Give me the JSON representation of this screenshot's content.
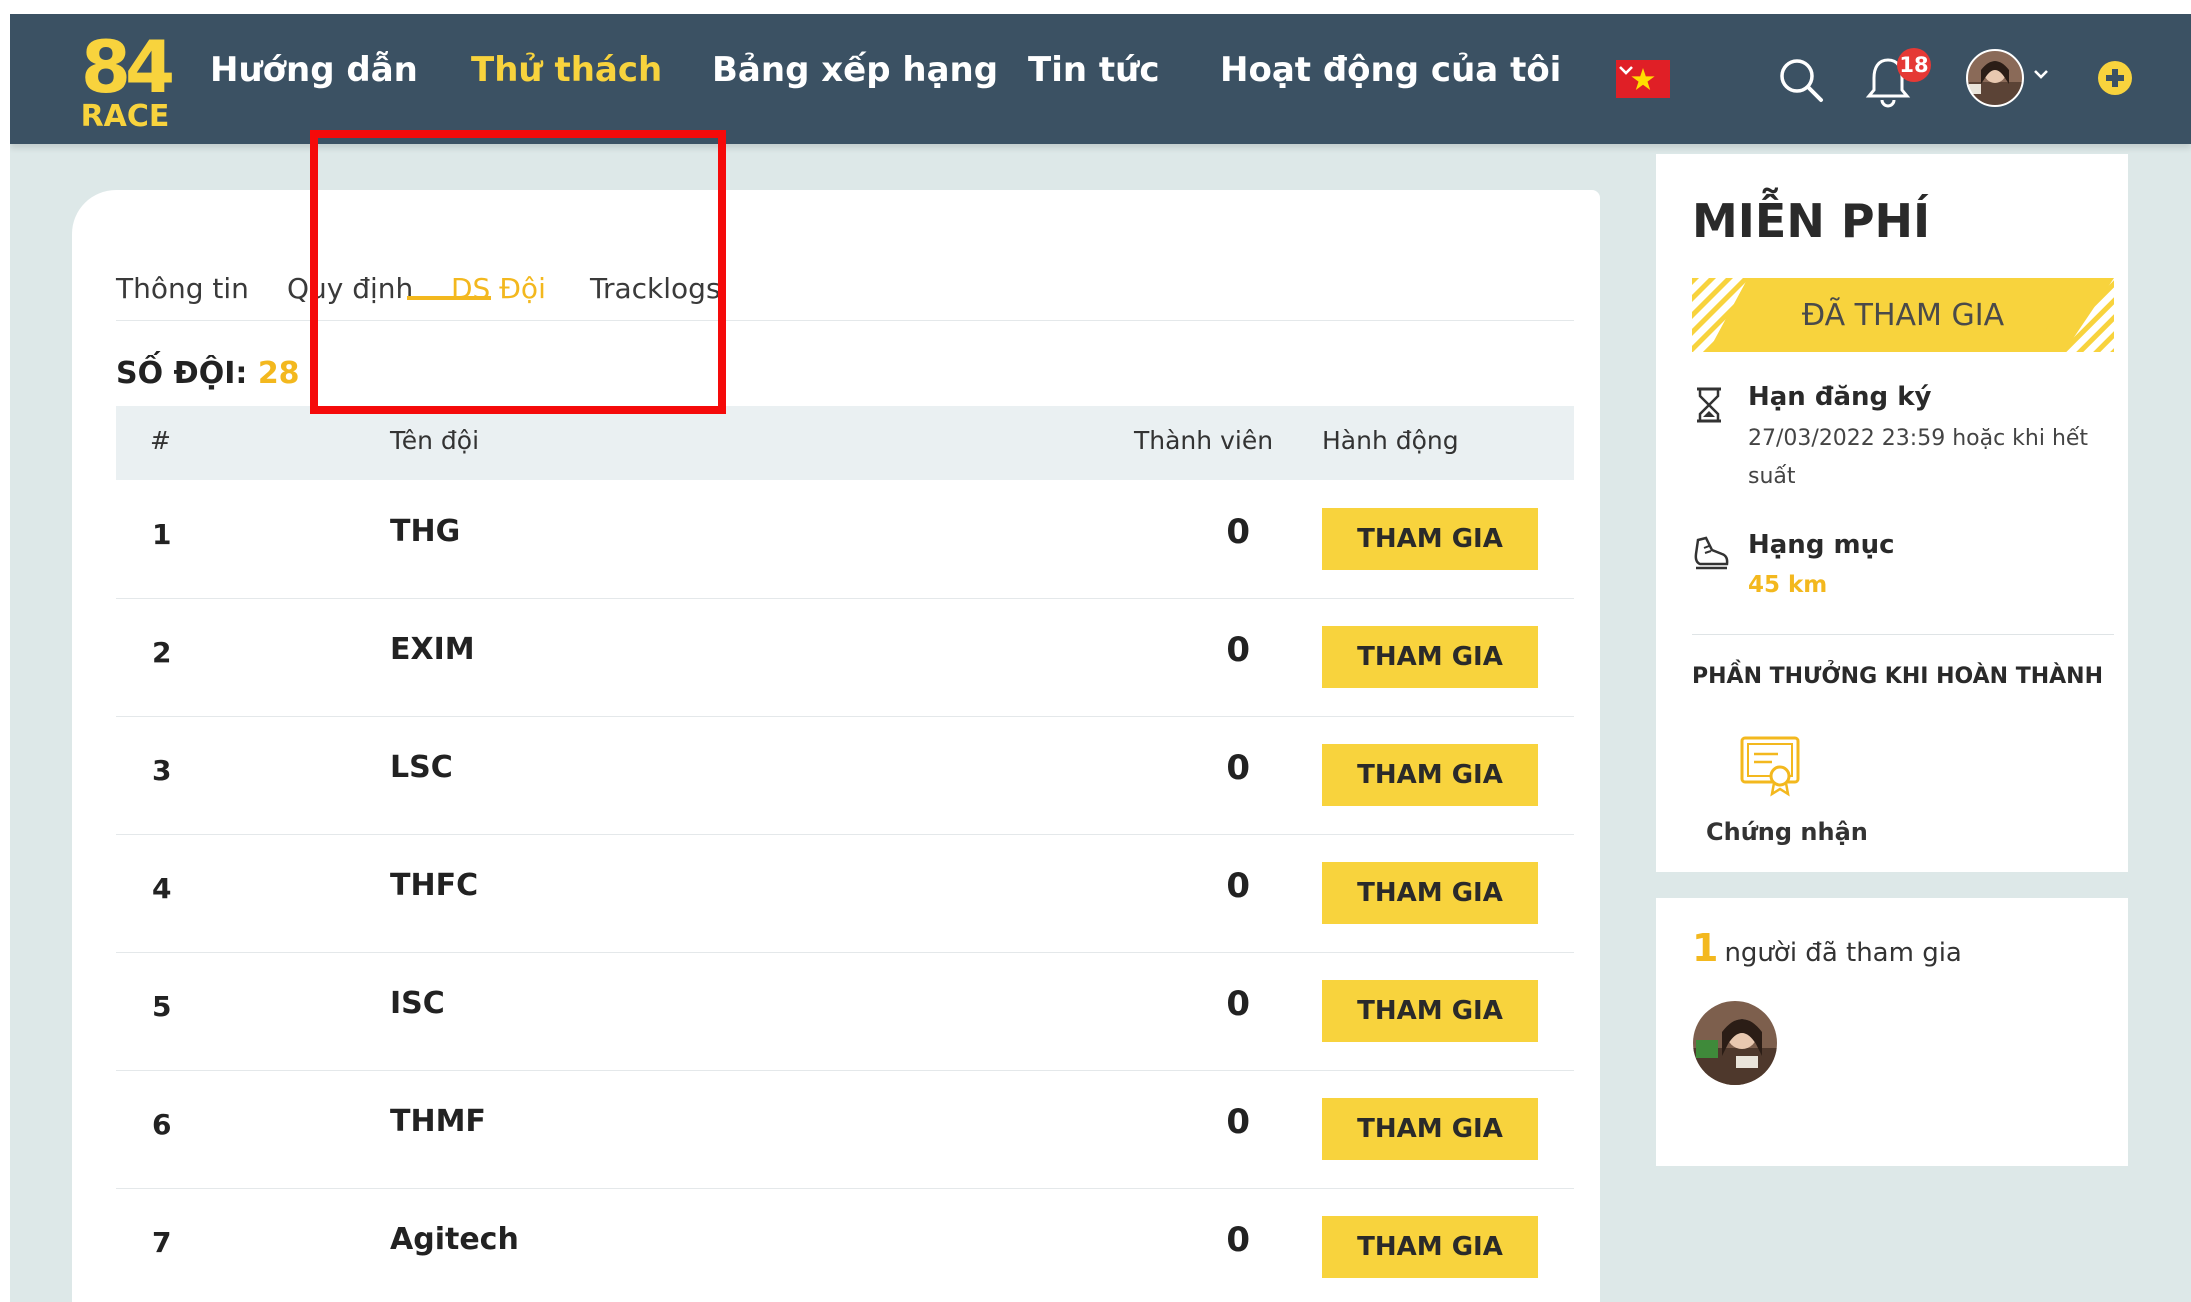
{
  "navbar": {
    "logo_top": "84",
    "logo_bottom": "RACE",
    "items": [
      {
        "label": "Hướng dẫn",
        "active": false
      },
      {
        "label": "Thử thách",
        "active": true
      },
      {
        "label": "Bảng xếp hạng",
        "active": false
      },
      {
        "label": "Tin tức",
        "active": false
      },
      {
        "label": "Hoạt động của tôi",
        "active": false
      }
    ],
    "language_flag": "vietnam-flag-icon",
    "notification_count": "18",
    "icons": [
      "search-icon",
      "bell-icon",
      "avatar",
      "plus-circle-icon",
      "chevron-down-icon"
    ]
  },
  "tabs": [
    {
      "label": "Thông tin",
      "active": false
    },
    {
      "label": "Quy định",
      "active": false
    },
    {
      "label": "DS Đội",
      "active": true
    },
    {
      "label": "Tracklogs",
      "active": false
    }
  ],
  "team_count": {
    "label": "SỐ ĐỘI:",
    "value": "28"
  },
  "table": {
    "headers": [
      "#",
      "Tên đội",
      "Thành viên",
      "Hành động"
    ],
    "rows": [
      {
        "num": "1",
        "name": "THG",
        "members": "0",
        "action": "THAM GIA"
      },
      {
        "num": "2",
        "name": "EXIM",
        "members": "0",
        "action": "THAM GIA"
      },
      {
        "num": "3",
        "name": "LSC",
        "members": "0",
        "action": "THAM GIA"
      },
      {
        "num": "4",
        "name": "THFC",
        "members": "0",
        "action": "THAM GIA"
      },
      {
        "num": "5",
        "name": "ISC",
        "members": "0",
        "action": "THAM GIA"
      },
      {
        "num": "6",
        "name": "THMF",
        "members": "0",
        "action": "THAM GIA"
      },
      {
        "num": "7",
        "name": "Agitech",
        "members": "0",
        "action": "THAM GIA"
      }
    ]
  },
  "sidebar": {
    "price": "MIỄN PHÍ",
    "joined_label": "ĐÃ THAM GIA",
    "deadline_label": "Hạn đăng ký",
    "deadline_value": "27/03/2022 23:59 hoặc khi hết suất",
    "category_label": "Hạng mục",
    "category_value": "45 km",
    "reward_title": "PHẦN THƯỞNG KHI HOÀN THÀNH",
    "reward_item": "Chứng nhận"
  },
  "participants": {
    "count": "1",
    "label": "người đã tham gia"
  },
  "colors": {
    "navbar_bg": "#3b5163",
    "accent_yellow": "#f8d33d",
    "accent_orange": "#f3b81e",
    "page_bg": "#dde8e8",
    "annotation_red": "#f50a0a"
  }
}
